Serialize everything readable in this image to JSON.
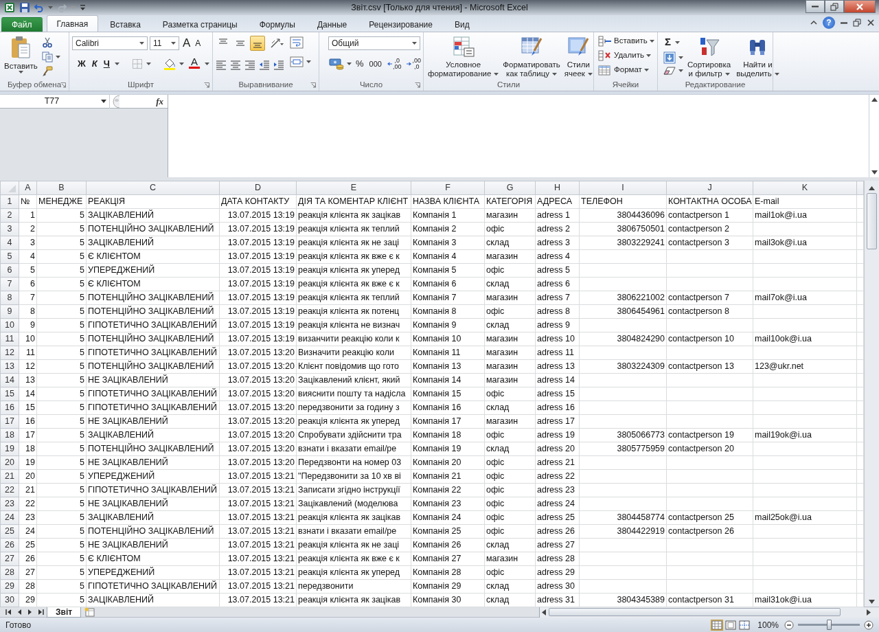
{
  "window": {
    "title": "Звіт.csv  [Только для чтения]  -  Microsoft Excel"
  },
  "tabs": [
    {
      "label": "Файл",
      "kind": "file",
      "selected": false
    },
    {
      "label": "Главная",
      "kind": "tab",
      "selected": true
    },
    {
      "label": "Вставка",
      "kind": "tab",
      "selected": false
    },
    {
      "label": "Разметка страницы",
      "kind": "tab",
      "selected": false
    },
    {
      "label": "Формулы",
      "kind": "tab",
      "selected": false
    },
    {
      "label": "Данные",
      "kind": "tab",
      "selected": false
    },
    {
      "label": "Рецензирование",
      "kind": "tab",
      "selected": false
    },
    {
      "label": "Вид",
      "kind": "tab",
      "selected": false
    }
  ],
  "help": "?",
  "ribbon": {
    "clipboard": {
      "label": "Буфер обмена",
      "paste": "Вставить"
    },
    "font": {
      "label": "Шрифт",
      "name": "Calibri",
      "size": "11",
      "grow": "A",
      "shrink": "A",
      "bold": "Ж",
      "italic": "К",
      "underline": "Ч",
      "font_color": "A"
    },
    "alignment": {
      "label": "Выравнивание",
      "vertical": [
        {
          "selected": false
        },
        {
          "selected": false
        },
        {
          "selected": true
        }
      ]
    },
    "number": {
      "label": "Число",
      "format": "Общий",
      "percent": "%",
      "thousands": "000",
      "more_decimals": [
        ",0",
        ",00"
      ],
      "fewer_decimals": [
        ",00",
        ",0"
      ]
    },
    "styles": {
      "label": "Стили",
      "conditional": [
        "Условное",
        "форматирование"
      ],
      "as_table": [
        "Форматировать",
        "как таблицу"
      ],
      "cell_styles": [
        "Стили",
        "ячеек"
      ]
    },
    "cells": {
      "label": "Ячейки",
      "insert": "Вставить",
      "delete": "Удалить",
      "format": "Формат"
    },
    "editing": {
      "label": "Редактирование",
      "sum": "Σ",
      "sort": [
        "Сортировка",
        "и фильтр"
      ],
      "find": [
        "Найти и",
        "выделить"
      ]
    }
  },
  "formula_bar": {
    "name_box": "T77",
    "fx": "fx"
  },
  "sheet": {
    "columns": [
      {
        "letter": "A",
        "kind": "number"
      },
      {
        "letter": "B",
        "kind": "number"
      },
      {
        "letter": "C",
        "kind": "text"
      },
      {
        "letter": "D",
        "kind": "number"
      },
      {
        "letter": "E",
        "kind": "text"
      },
      {
        "letter": "F",
        "kind": "text"
      },
      {
        "letter": "G",
        "kind": "text"
      },
      {
        "letter": "H",
        "kind": "text"
      },
      {
        "letter": "I",
        "kind": "number"
      },
      {
        "letter": "J",
        "kind": "text"
      },
      {
        "letter": "K",
        "kind": "text"
      }
    ],
    "rows": [
      {
        "number": "1",
        "kind": "header",
        "cells": [
          "№",
          "МЕНЕДЖЕ",
          "РЕАКЦІЯ",
          "ДАТА КОНТАКТУ",
          "ДІЯ ТА КОМЕНТАР КЛІЄНТ",
          "НАЗВА КЛІЄНТА",
          "КАТЕГОРІЯ",
          "АДРЕСА",
          "ТЕЛЕФОН",
          "КОНТАКТНА ОСОБА",
          "E-mail"
        ]
      },
      {
        "number": "2",
        "kind": "record",
        "cells": [
          "1",
          "5",
          "ЗАЦІКАВЛЕНИЙ",
          "13.07.2015 13:19",
          "реакція клієнта як зацікав",
          "Компанія 1",
          "магазин",
          "adress 1",
          "3804436096",
          "contactperson 1",
          "mail1ok@i.ua"
        ]
      },
      {
        "number": "3",
        "kind": "record",
        "cells": [
          "2",
          "5",
          "ПОТЕНЦІЙНО ЗАЦІКАВЛЕНИЙ",
          "13.07.2015 13:19",
          "реакція клієнта як теплий",
          "Компанія 2",
          "офіс",
          "adress 2",
          "3806750501",
          "contactperson 2"
        ]
      },
      {
        "number": "4",
        "kind": "record",
        "cells": [
          "3",
          "5",
          "ЗАЦІКАВЛЕНИЙ",
          "13.07.2015 13:19",
          "реакція клієнта як не заці",
          "Компанія 3",
          "склад",
          "adress 3",
          "3803229241",
          "contactperson 3",
          "mail3ok@i.ua"
        ]
      },
      {
        "number": "5",
        "kind": "record",
        "cells": [
          "4",
          "5",
          "Є КЛІЄНТОМ",
          "13.07.2015 13:19",
          "реакція клієнта як вже є к",
          "Компанія 4",
          "магазин",
          "adress 4"
        ]
      },
      {
        "number": "6",
        "kind": "record",
        "cells": [
          "5",
          "5",
          "УПЕРЕДЖЕНИЙ",
          "13.07.2015 13:19",
          "реакція клієнта як уперед",
          "Компанія 5",
          "офіс",
          "adress 5"
        ]
      },
      {
        "number": "7",
        "kind": "record",
        "cells": [
          "6",
          "5",
          "Є КЛІЄНТОМ",
          "13.07.2015 13:19",
          "реакція клієнта як вже є к",
          "Компанія 6",
          "склад",
          "adress 6"
        ]
      },
      {
        "number": "8",
        "kind": "record",
        "cells": [
          "7",
          "5",
          "ПОТЕНЦІЙНО ЗАЦІКАВЛЕНИЙ",
          "13.07.2015 13:19",
          "реакція клієнта як теплий",
          "Компанія 7",
          "магазин",
          "adress 7",
          "3806221002",
          "contactperson 7",
          "mail7ok@i.ua"
        ]
      },
      {
        "number": "9",
        "kind": "record",
        "cells": [
          "8",
          "5",
          "ПОТЕНЦІЙНО ЗАЦІКАВЛЕНИЙ",
          "13.07.2015 13:19",
          "реакція клієнта як потенц",
          "Компанія 8",
          "офіс",
          "adress 8",
          "3806454961",
          "contactperson 8"
        ]
      },
      {
        "number": "10",
        "kind": "record",
        "cells": [
          "9",
          "5",
          "ГІПОТЕТИЧНО ЗАЦІКАВЛЕНИЙ",
          "13.07.2015 13:19",
          "реакція клієнта не визнач",
          "Компанія 9",
          "склад",
          "adress 9"
        ]
      },
      {
        "number": "11",
        "kind": "record",
        "cells": [
          "10",
          "5",
          "ПОТЕНЦІЙНО ЗАЦІКАВЛЕНИЙ",
          "13.07.2015 13:19",
          "визанчити реакцію коли к",
          "Компанія 10",
          "магазин",
          "adress 10",
          "3804824290",
          "contactperson 10",
          "mail10ok@i.ua"
        ]
      },
      {
        "number": "12",
        "kind": "record",
        "cells": [
          "11",
          "5",
          "ГІПОТЕТИЧНО ЗАЦІКАВЛЕНИЙ",
          "13.07.2015 13:20",
          "Визначити реакцію коли",
          "Компанія 11",
          "магазин",
          "adress 11"
        ]
      },
      {
        "number": "13",
        "kind": "record",
        "cells": [
          "12",
          "5",
          "ПОТЕНЦІЙНО ЗАЦІКАВЛЕНИЙ",
          "13.07.2015 13:20",
          "Клієнт повідомив що гото",
          "Компанія 13",
          "магазин",
          "adress 13",
          "3803224309",
          "contactperson 13",
          "123@ukr.net"
        ]
      },
      {
        "number": "14",
        "kind": "record",
        "cells": [
          "13",
          "5",
          "НЕ ЗАЦІКАВЛЕНИЙ",
          "13.07.2015 13:20",
          "Зацікавлений клієнт, який",
          "Компанія 14",
          "магазин",
          "adress 14"
        ]
      },
      {
        "number": "15",
        "kind": "record",
        "cells": [
          "14",
          "5",
          "ГІПОТЕТИЧНО ЗАЦІКАВЛЕНИЙ",
          "13.07.2015 13:20",
          "вияснити пошту та надісла",
          "Компанія 15",
          "офіс",
          "adress 15"
        ]
      },
      {
        "number": "16",
        "kind": "record",
        "cells": [
          "15",
          "5",
          "ГІПОТЕТИЧНО ЗАЦІКАВЛЕНИЙ",
          "13.07.2015 13:20",
          "передзвонити за годину з",
          "Компанія 16",
          "склад",
          "adress 16"
        ]
      },
      {
        "number": "17",
        "kind": "record",
        "cells": [
          "16",
          "5",
          "НЕ ЗАЦІКАВЛЕНИЙ",
          "13.07.2015 13:20",
          "реакція клієнта як уперед",
          "Компанія 17",
          "магазин",
          "adress 17"
        ]
      },
      {
        "number": "18",
        "kind": "record",
        "cells": [
          "17",
          "5",
          "ЗАЦІКАВЛЕНИЙ",
          "13.07.2015 13:20",
          "Спробувати здійснити тра",
          "Компанія 18",
          "офіс",
          "adress 19",
          "3805066773",
          "contactperson 19",
          "mail19ok@i.ua"
        ]
      },
      {
        "number": "19",
        "kind": "record",
        "cells": [
          "18",
          "5",
          "ПОТЕНЦІЙНО ЗАЦІКАВЛЕНИЙ",
          "13.07.2015 13:20",
          "взнати і вказати email/ре",
          "Компанія 19",
          "склад",
          "adress 20",
          "3805775959",
          "contactperson 20"
        ]
      },
      {
        "number": "20",
        "kind": "record",
        "cells": [
          "19",
          "5",
          "НЕ ЗАЦІКАВЛЕНИЙ",
          "13.07.2015 13:20",
          "Передзвонти на номер 03",
          "Компанія 20",
          "офіс",
          "adress 21"
        ]
      },
      {
        "number": "21",
        "kind": "record",
        "cells": [
          "20",
          "5",
          "УПЕРЕДЖЕНИЙ",
          "13.07.2015 13:21",
          "\"Передзвонити за 10 хв ві",
          "Компанія 21",
          "офіс",
          "adress 22"
        ]
      },
      {
        "number": "22",
        "kind": "record",
        "cells": [
          "21",
          "5",
          "ГІПОТЕТИЧНО ЗАЦІКАВЛЕНИЙ",
          "13.07.2015 13:21",
          "Записати згідно інструкції",
          "Компанія 22",
          "офіс",
          "adress 23"
        ]
      },
      {
        "number": "23",
        "kind": "record",
        "cells": [
          "22",
          "5",
          "НЕ ЗАЦІКАВЛЕНИЙ",
          "13.07.2015 13:21",
          "Зацікавлений (моделюва",
          "Компанія 23",
          "офіс",
          "adress 24"
        ]
      },
      {
        "number": "24",
        "kind": "record",
        "cells": [
          "23",
          "5",
          "ЗАЦІКАВЛЕНИЙ",
          "13.07.2015 13:21",
          "реакція клієнта як зацікав",
          "Компанія 24",
          "офіс",
          "adress 25",
          "3804458774",
          "contactperson 25",
          "mail25ok@i.ua"
        ]
      },
      {
        "number": "25",
        "kind": "record",
        "cells": [
          "24",
          "5",
          "ПОТЕНЦІЙНО ЗАЦІКАВЛЕНИЙ",
          "13.07.2015 13:21",
          "взнати і вказати email/ре",
          "Компанія 25",
          "офіс",
          "adress 26",
          "3804422919",
          "contactperson 26"
        ]
      },
      {
        "number": "26",
        "kind": "record",
        "cells": [
          "25",
          "5",
          "НЕ ЗАЦІКАВЛЕНИЙ",
          "13.07.2015 13:21",
          "реакція клієнта як не заці",
          "Компанія 26",
          "склад",
          "adress 27"
        ]
      },
      {
        "number": "27",
        "kind": "record",
        "cells": [
          "26",
          "5",
          "Є КЛІЄНТОМ",
          "13.07.2015 13:21",
          "реакція клієнта як вже є к",
          "Компанія 27",
          "магазин",
          "adress 28"
        ]
      },
      {
        "number": "28",
        "kind": "record",
        "cells": [
          "27",
          "5",
          "УПЕРЕДЖЕНИЙ",
          "13.07.2015 13:21",
          "реакція клієнта як уперед",
          "Компанія 28",
          "офіс",
          "adress 29"
        ]
      },
      {
        "number": "29",
        "kind": "record",
        "cells": [
          "28",
          "5",
          "ГІПОТЕТИЧНО ЗАЦІКАВЛЕНИЙ",
          "13.07.2015 13:21",
          "передзвонити",
          "Компанія 29",
          "склад",
          "adress 30"
        ]
      },
      {
        "number": "30",
        "kind": "record",
        "cells": [
          "29",
          "5",
          "ЗАЦІКАВЛЕНИЙ",
          "13.07.2015 13:21",
          "реакція клієнта як зацікав",
          "Компанія 30",
          "склад",
          "adress 31",
          "3804345389",
          "contactperson 31",
          "mail31ok@i.ua"
        ]
      }
    ]
  },
  "sheet_tabs": [
    {
      "label": "Звіт",
      "selected": true
    }
  ],
  "status_bar": {
    "text": "Готово",
    "views": [
      {
        "selected": true
      },
      {
        "selected": false
      },
      {
        "selected": false
      }
    ],
    "zoom": "100%",
    "zoom_slider": {
      "level": 0.5
    }
  }
}
